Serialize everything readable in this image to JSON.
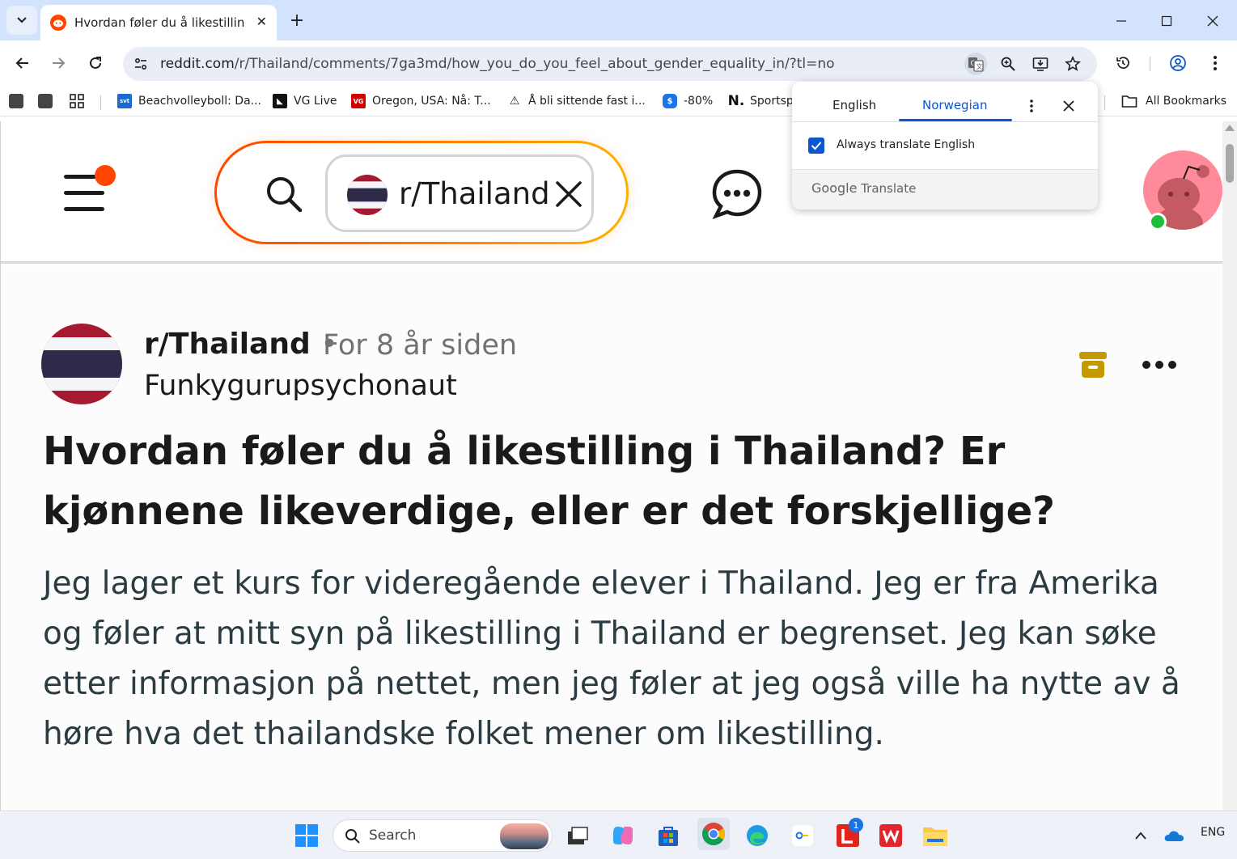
{
  "browser": {
    "tab_title": "Hvordan føler du å likestilling i Thailand? Er kjønnene likeverdige, eller er det forskjellige?",
    "url_host": "reddit.com",
    "url_path": "/r/Thailand/comments/7ga3md/how_you_do_you_feel_about_gender_equality_in/?tl=no",
    "bookmarks": [
      {
        "label": "Beachvolleyboll: Da...",
        "icon": "svt"
      },
      {
        "label": "VG Live",
        "icon": "vg-live"
      },
      {
        "label": "Oregon, USA: Nå: T...",
        "icon": "VG"
      },
      {
        "label": "Å bli sittende fast i...",
        "icon": "warning"
      },
      {
        "label": "-80%",
        "icon": "tag"
      },
      {
        "label": "Sportsp",
        "icon": "N."
      }
    ],
    "all_bookmarks": "All Bookmarks"
  },
  "translate_popup": {
    "source_lang": "English",
    "target_lang": "Norwegian",
    "always_translate_label": "Always translate English",
    "always_translate_checked": true,
    "footer_brand": "Google",
    "footer_product": "Translate"
  },
  "reddit": {
    "search_chip": "r/Thailand",
    "post": {
      "subreddit": "r/Thailand",
      "separator": "•",
      "time": "For 8 år siden",
      "author": "Funkygurupsychonaut",
      "title": "Hvordan føler du å likestilling i Thailand? Er kjønnene likeverdige, eller er det forskjellige?",
      "body": "Jeg lager et kurs for videregående elever i Thailand. Jeg er fra Amerika og føler at mitt syn på likestilling i Thailand er begrenset. Jeg kan søke etter informasjon på nettet, men jeg føler at jeg også ville ha nytte av å høre hva det thailandske folket mener om likestilling."
    }
  },
  "taskbar": {
    "search_label": "Search",
    "lang": "ENG",
    "lens_badge": "1"
  },
  "colors": {
    "reddit_orange": "#ff4500",
    "chrome_tabstrip": "#d3e3fd",
    "google_blue": "#0b57d0",
    "online_green": "#1dbe3c",
    "archive_gold": "#c49a00"
  }
}
